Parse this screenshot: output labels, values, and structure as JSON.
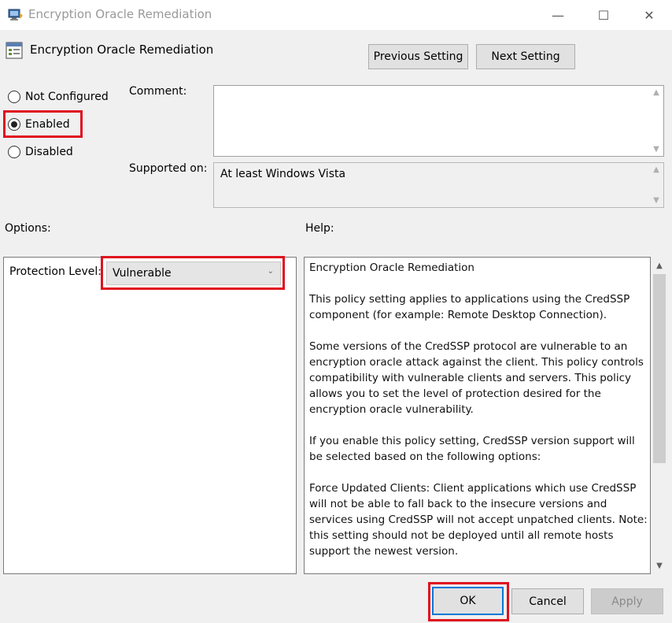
{
  "window": {
    "title": "Encryption Oracle Remediation",
    "minimize_glyph": "—",
    "maximize_glyph": "☐",
    "close_glyph": "✕"
  },
  "header": {
    "title": "Encryption Oracle Remediation",
    "prev_label": "Previous Setting",
    "next_label": "Next Setting"
  },
  "state": {
    "options": [
      {
        "label": "Not Configured",
        "checked": false
      },
      {
        "label": "Enabled",
        "checked": true
      },
      {
        "label": "Disabled",
        "checked": false
      }
    ]
  },
  "comment": {
    "label": "Comment:",
    "value": ""
  },
  "supported": {
    "label": "Supported on:",
    "value": "At least Windows Vista"
  },
  "options_panel": {
    "label": "Options:",
    "protection_label": "Protection Level:",
    "protection_value": "Vulnerable"
  },
  "help": {
    "label": "Help:",
    "paragraphs": [
      "Encryption Oracle Remediation",
      "This policy setting applies to applications using the CredSSP component (for example: Remote Desktop Connection).",
      "Some versions of the CredSSP protocol are vulnerable to an encryption oracle attack against the client.  This policy controls compatibility with vulnerable clients and servers.  This policy allows you to set the level of protection desired for the encryption oracle vulnerability.",
      "If you enable this policy setting, CredSSP version support will be selected based on the following options:",
      "Force Updated Clients: Client applications which use CredSSP will not be able to fall back to the insecure versions and services using CredSSP will not accept unpatched clients. Note: this setting should not be deployed until all remote hosts support the newest version."
    ]
  },
  "footer": {
    "ok_label": "OK",
    "cancel_label": "Cancel",
    "apply_label": "Apply"
  },
  "colors": {
    "highlight": "#e0101e",
    "focus": "#0078d7"
  }
}
